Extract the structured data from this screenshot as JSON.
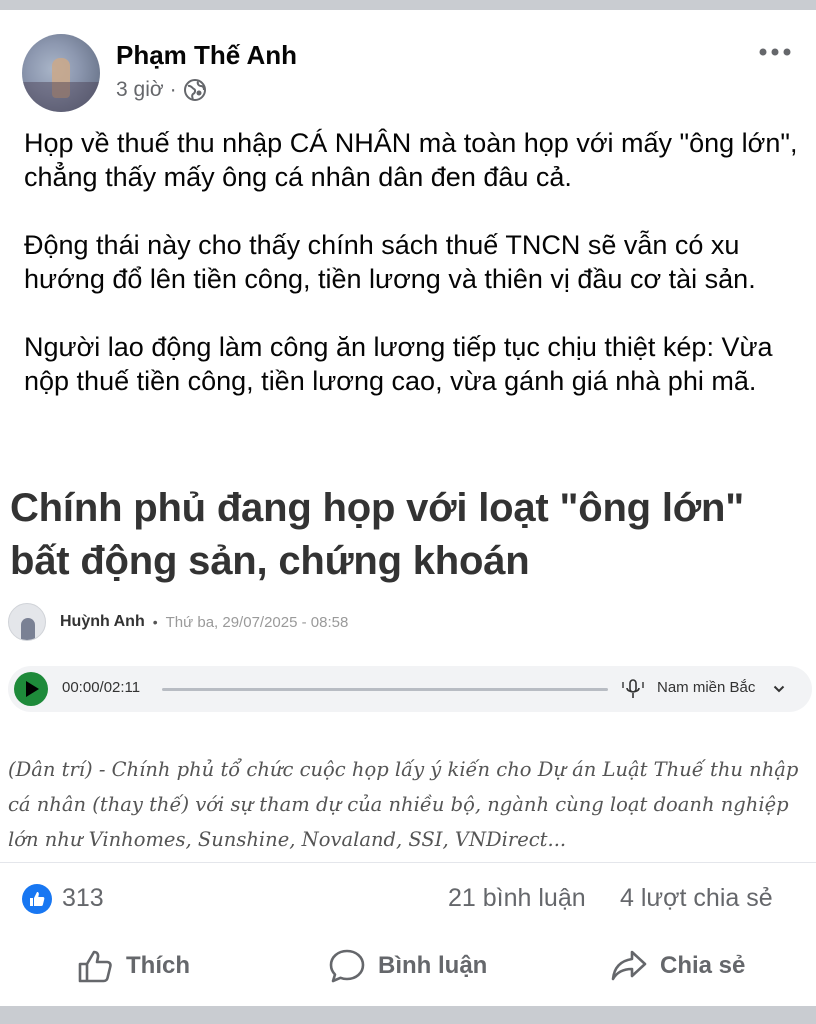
{
  "post": {
    "author": "Phạm Thế Anh",
    "time": "3 giờ",
    "separator": "·",
    "paragraphs": [
      "Họp về thuế thu nhập CÁ NHÂN mà toàn họp với mấy \"ông lớn\", chẳng thấy mấy ông cá nhân dân đen đâu cả.",
      "Động thái này cho thấy chính sách thuế TNCN sẽ vẫn có xu hướng đổ lên tiền công, tiền lương và thiên vị đầu cơ tài sản.",
      "Người lao động làm công ăn lương tiếp tục chịu thiệt kép: Vừa nộp thuế tiền công, tiền lương cao, vừa gánh giá nhà phi mã."
    ]
  },
  "article": {
    "title": "Chính phủ đang họp với loạt \"ông lớn\" bất động sản, chứng khoán",
    "author": "Huỳnh Anh",
    "bullet": "•",
    "date": "Thứ ba, 29/07/2025 - 08:58",
    "player": {
      "time": "00:00/02:11",
      "voice": "Nam miền Bắc",
      "progress": 0
    },
    "lead": "(Dân trí) - Chính phủ tổ chức cuộc họp lấy ý kiến cho Dự án Luật Thuế thu nhập cá nhân (thay thế) với sự tham dự của nhiều bộ, ngành cùng loạt doanh nghiệp lớn như Vinhomes, Sunshine, Novaland, SSI, VNDirect..."
  },
  "stats": {
    "likes": "313",
    "comments": "21 bình luận",
    "shares": "4 lượt chia sẻ"
  },
  "actions": {
    "like": "Thích",
    "comment": "Bình luận",
    "share": "Chia sẻ"
  },
  "colors": {
    "accent": "#1877f2",
    "secondary_text": "#65676b",
    "play_button": "#1e8a3a"
  },
  "icons": [
    "globe-icon",
    "more-icon",
    "play-icon",
    "mic-icon",
    "chevron-down-icon",
    "like-badge-icon",
    "like-icon",
    "comment-icon",
    "share-icon"
  ]
}
